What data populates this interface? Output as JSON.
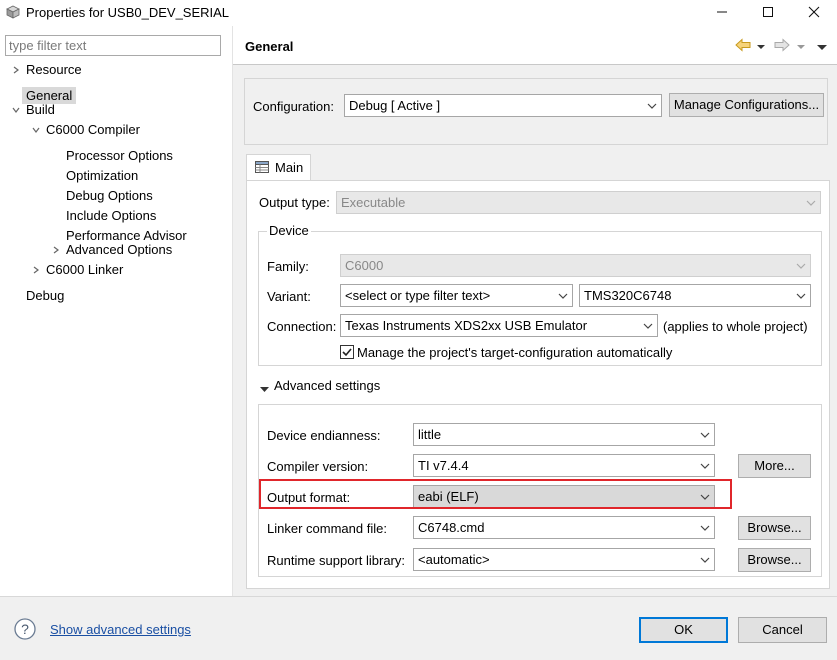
{
  "window": {
    "title": "Properties for USB0_DEV_SERIAL",
    "minimize_icon": "minimize-icon",
    "maximize_icon": "maximize-icon",
    "close_icon": "close-icon"
  },
  "left_pane": {
    "filter_placeholder": "type filter text",
    "tree": [
      {
        "label": "Resource",
        "expander": "collapsed",
        "level": 0
      },
      {
        "label": "General",
        "expander": "none",
        "level": 0,
        "selected": true
      },
      {
        "label": "Build",
        "expander": "expanded",
        "level": 0
      },
      {
        "label": "C6000 Compiler",
        "expander": "expanded",
        "level": 1
      },
      {
        "label": "Processor Options",
        "expander": "none",
        "level": 2
      },
      {
        "label": "Optimization",
        "expander": "none",
        "level": 2
      },
      {
        "label": "Debug Options",
        "expander": "none",
        "level": 2
      },
      {
        "label": "Include Options",
        "expander": "none",
        "level": 2
      },
      {
        "label": "Performance Advisor",
        "expander": "none",
        "level": 2
      },
      {
        "label": "Advanced Options",
        "expander": "collapsed",
        "level": 2
      },
      {
        "label": "C6000 Linker",
        "expander": "collapsed",
        "level": 1
      },
      {
        "label": "Debug",
        "expander": "none",
        "level": 0
      }
    ]
  },
  "right_pane": {
    "title": "General",
    "nav_icons": [
      "back-arrow-icon",
      "forward-arrow-icon",
      "view-menu-icon"
    ],
    "configuration": {
      "label": "Configuration:",
      "value": "Debug  [ Active ]",
      "manage_button": "Manage Configurations..."
    },
    "tab": {
      "label": "Main",
      "icon": "table-icon"
    },
    "output_type": {
      "label": "Output type:",
      "value": "Executable"
    },
    "device": {
      "group_label": "Device",
      "family": {
        "label": "Family:",
        "value": "C6000"
      },
      "variant": {
        "label": "Variant:",
        "filter_value": "<select or type filter text>",
        "value": "TMS320C6748"
      },
      "connection": {
        "label": "Connection:",
        "value": "Texas Instruments XDS2xx USB Emulator",
        "note": "(applies to whole project)"
      },
      "manage_checkbox": {
        "label": "Manage the project's target-configuration automatically",
        "checked": true
      }
    },
    "advanced": {
      "section_label": "Advanced settings",
      "endianness": {
        "label": "Device endianness:",
        "value": "little"
      },
      "compiler_version": {
        "label": "Compiler version:",
        "value": "TI v7.4.4",
        "button": "More..."
      },
      "output_format": {
        "label": "Output format:",
        "value": "eabi (ELF)",
        "highlight_color": "#e0262b"
      },
      "linker_cmd": {
        "label": "Linker command file:",
        "value": "C6748.cmd",
        "button": "Browse..."
      },
      "runtime_lib": {
        "label": "Runtime support library:",
        "value": "<automatic>",
        "button": "Browse..."
      }
    }
  },
  "footer": {
    "help_icon": "help-icon",
    "show_advanced_link": "Show advanced settings",
    "ok_button": "OK",
    "cancel_button": "Cancel"
  }
}
